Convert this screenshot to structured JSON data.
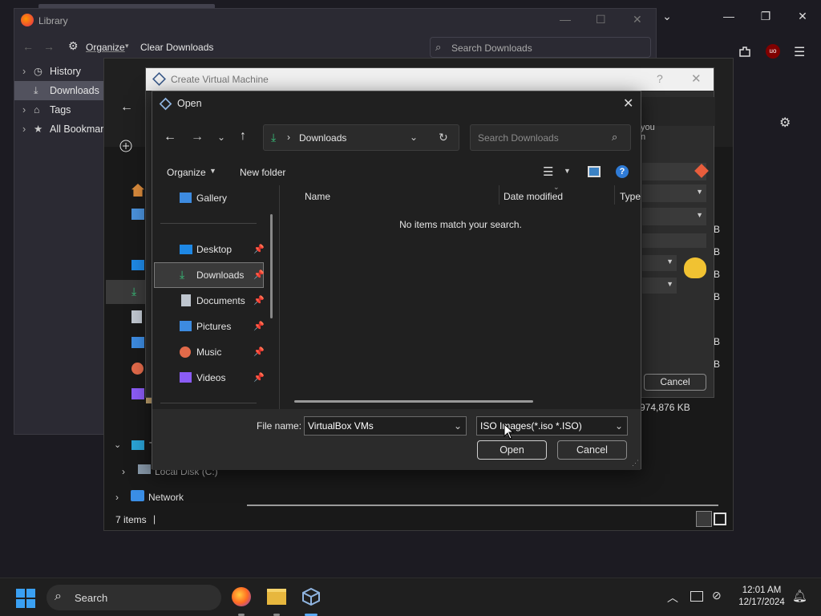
{
  "library": {
    "title": "Library",
    "organize": "Organize",
    "clear_downloads": "Clear Downloads",
    "search_placeholder": "Search Downloads",
    "tree": [
      {
        "label": "History"
      },
      {
        "label": "Downloads"
      },
      {
        "label": "Tags"
      },
      {
        "label": "All Bookmarks"
      }
    ]
  },
  "explorer": {
    "status_items": "7 items",
    "size_label": "974,876 KB",
    "tree": [
      {
        "label": "Local Disk (C:)"
      },
      {
        "label": "Network"
      }
    ],
    "size_fragments": [
      "B",
      "B",
      "B",
      "B",
      "B",
      "B"
    ]
  },
  "create_vm": {
    "title": "Create Virtual Machine",
    "help": "?",
    "cancel": "Cancel",
    "partial_text": "you\nn"
  },
  "open_dialog": {
    "title": "Open",
    "address_folder": "Downloads",
    "search_placeholder": "Search Downloads",
    "organize": "Organize",
    "new_folder": "New folder",
    "columns": {
      "name": "Name",
      "date_modified": "Date modified",
      "type": "Type"
    },
    "empty_message": "No items match your search.",
    "nav": [
      {
        "label": "Gallery",
        "icon": "gallery-icon"
      },
      {
        "label": "Desktop",
        "icon": "desktop-icon"
      },
      {
        "label": "Downloads",
        "icon": "download-icon"
      },
      {
        "label": "Documents",
        "icon": "documents-icon"
      },
      {
        "label": "Pictures",
        "icon": "pictures-icon"
      },
      {
        "label": "Music",
        "icon": "music-icon"
      },
      {
        "label": "Videos",
        "icon": "videos-icon"
      }
    ],
    "file_name_label": "File name:",
    "file_name_value": "VirtualBox VMs",
    "file_type_value": "ISO Images(*.iso *.ISO)",
    "open_button": "Open",
    "cancel_button": "Cancel"
  },
  "taskbar": {
    "search": "Search",
    "time": "12:01 AM",
    "date": "12/17/2024"
  }
}
